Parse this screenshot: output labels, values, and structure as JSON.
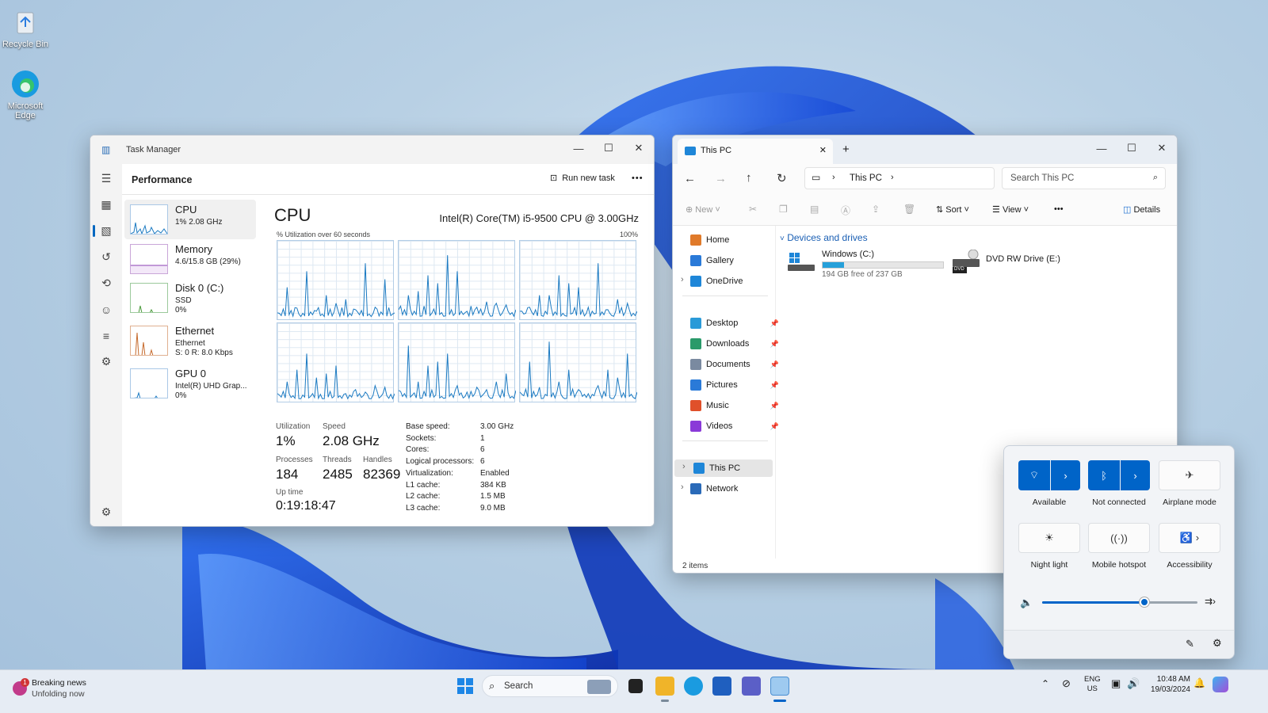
{
  "desktop": {
    "recycle_bin": "Recycle Bin",
    "edge_line1": "Microsoft",
    "edge_line2": "Edge"
  },
  "task_manager": {
    "title": "Task Manager",
    "section": "Performance",
    "run_new_task": "Run new task",
    "more": "•••",
    "items": [
      {
        "name": "CPU",
        "sub1": "1% 2.08 GHz",
        "sub2": "",
        "sub3": ""
      },
      {
        "name": "Memory",
        "sub1": "4.6/15.8 GB (29%)",
        "sub2": "",
        "sub3": ""
      },
      {
        "name": "Disk 0 (C:)",
        "sub1": "SSD",
        "sub2": "0%",
        "sub3": ""
      },
      {
        "name": "Ethernet",
        "sub1": "Ethernet",
        "sub2": "S: 0 R: 8.0 Kbps",
        "sub3": ""
      },
      {
        "name": "GPU 0",
        "sub1": "Intel(R) UHD Grap...",
        "sub2": "0%",
        "sub3": ""
      }
    ],
    "heading": "CPU",
    "cpu_model": "Intel(R) Core(TM) i5-9500 CPU @ 3.00GHz",
    "graph_caption": "% Utilization over 60 seconds",
    "graph_max": "100%",
    "stats": {
      "utilization_label": "Utilization",
      "utilization": "1%",
      "speed_label": "Speed",
      "speed": "2.08 GHz",
      "processes_label": "Processes",
      "processes": "184",
      "threads_label": "Threads",
      "threads": "2485",
      "handles_label": "Handles",
      "handles": "82369",
      "uptime_label": "Up time",
      "uptime": "0:19:18:47"
    },
    "details": [
      {
        "k": "Base speed:",
        "v": "3.00 GHz"
      },
      {
        "k": "Sockets:",
        "v": "1"
      },
      {
        "k": "Cores:",
        "v": "6"
      },
      {
        "k": "Logical processors:",
        "v": "6"
      },
      {
        "k": "Virtualization:",
        "v": "Enabled"
      },
      {
        "k": "L1 cache:",
        "v": "384 KB"
      },
      {
        "k": "L2 cache:",
        "v": "1.5 MB"
      },
      {
        "k": "L3 cache:",
        "v": "9.0 MB"
      }
    ]
  },
  "explorer": {
    "tab_title": "This PC",
    "address": "This PC",
    "search_placeholder": "Search This PC",
    "new": "New",
    "sort": "Sort",
    "view": "View",
    "more": "•••",
    "details": "Details",
    "nav": [
      "Home",
      "Gallery",
      "OneDrive",
      "Desktop",
      "Downloads",
      "Documents",
      "Pictures",
      "Music",
      "Videos",
      "This PC",
      "Network"
    ],
    "group": "Devices and drives",
    "drive_c": {
      "name": "Windows (C:)",
      "free": "194 GB free of 237 GB",
      "used_fraction": 0.18
    },
    "drive_e": {
      "name": "DVD RW Drive (E:)",
      "badge": "DVD"
    },
    "status": "2 items"
  },
  "quick_settings": {
    "wifi": "Available",
    "bluetooth": "Not connected",
    "airplane": "Airplane mode",
    "nightlight": "Night light",
    "hotspot": "Mobile hotspot",
    "accessibility": "Accessibility",
    "volume_fraction": 0.66
  },
  "taskbar": {
    "news_title": "Breaking news",
    "news_sub": "Unfolding now",
    "news_badge": "1",
    "search": "Search",
    "lang1": "ENG",
    "lang2": "US",
    "time": "10:48 AM",
    "date": "19/03/2024"
  }
}
